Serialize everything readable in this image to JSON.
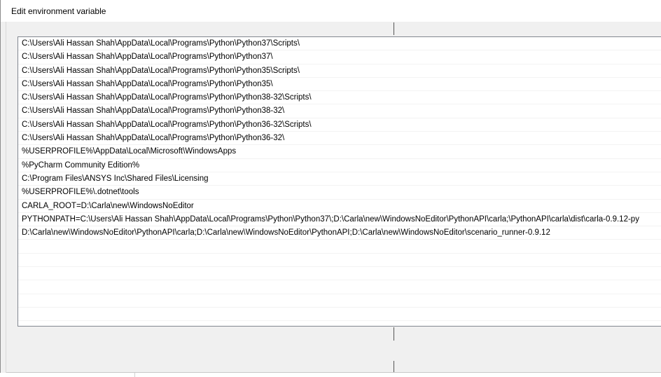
{
  "window": {
    "title": "Edit environment variable"
  },
  "list": {
    "items": [
      "C:\\Users\\Ali Hassan Shah\\AppData\\Local\\Programs\\Python\\Python37\\Scripts\\",
      "C:\\Users\\Ali Hassan Shah\\AppData\\Local\\Programs\\Python\\Python37\\",
      "C:\\Users\\Ali Hassan Shah\\AppData\\Local\\Programs\\Python\\Python35\\Scripts\\",
      "C:\\Users\\Ali Hassan Shah\\AppData\\Local\\Programs\\Python\\Python35\\",
      "C:\\Users\\Ali Hassan Shah\\AppData\\Local\\Programs\\Python\\Python38-32\\Scripts\\",
      "C:\\Users\\Ali Hassan Shah\\AppData\\Local\\Programs\\Python\\Python38-32\\",
      "C:\\Users\\Ali Hassan Shah\\AppData\\Local\\Programs\\Python\\Python36-32\\Scripts\\",
      "C:\\Users\\Ali Hassan Shah\\AppData\\Local\\Programs\\Python\\Python36-32\\",
      "%USERPROFILE%\\AppData\\Local\\Microsoft\\WindowsApps",
      "%PyCharm Community Edition%",
      "C:\\Program Files\\ANSYS Inc\\Shared Files\\Licensing",
      "%USERPROFILE%\\.dotnet\\tools",
      "CARLA_ROOT=D:\\Carla\\new\\WindowsNoEditor",
      "PYTHONPATH=C:\\Users\\Ali Hassan Shah\\AppData\\Local\\Programs\\Python\\Python37\\;D:\\Carla\\new\\WindowsNoEditor\\PythonAPI\\carla;\\PythonAPI\\carla\\dist\\carla-0.9.12-py",
      "D:\\Carla\\new\\WindowsNoEditor\\PythonAPI\\carla;D:\\Carla\\new\\WindowsNoEditor\\PythonAPI;D:\\Carla\\new\\WindowsNoEditor\\scenario_runner-0.9.12"
    ]
  }
}
